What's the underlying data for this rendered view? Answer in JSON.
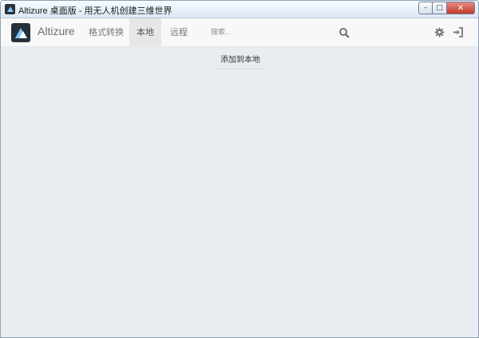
{
  "window": {
    "title": "Altizure 桌面版 - 用无人机创建三维世界",
    "controls": {
      "minimize": "–",
      "maximize": "□",
      "close": "✕"
    }
  },
  "navbar": {
    "brand": "Altizure",
    "items": [
      {
        "label": "格式转换",
        "active": false
      },
      {
        "label": "本地",
        "active": true
      },
      {
        "label": "远程",
        "active": false
      }
    ],
    "search_placeholder": "搜索..",
    "icons": [
      "search-icon",
      "gear-icon",
      "sign-in-icon"
    ]
  },
  "main": {
    "add_local_label": "添加到本地"
  },
  "colors": {
    "navbar_bg": "#f8f8f8",
    "active_tab_bg": "#e7e7e7",
    "content_bg": "#e9edf1"
  }
}
